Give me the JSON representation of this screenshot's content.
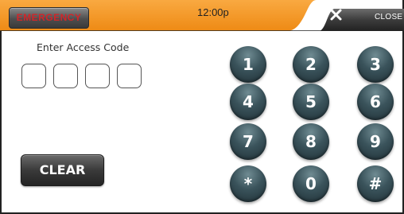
{
  "header": {
    "emergency_label": "EMERGENCY",
    "time": "12:00p",
    "close_label": "CLOSE",
    "bar_color": "#f5941f",
    "emergency_color": "#d0262a"
  },
  "access": {
    "label": "Enter Access Code",
    "digits_entered": 0,
    "boxes": 4
  },
  "clear_label": "CLEAR",
  "keypad": {
    "keys": [
      "1",
      "2",
      "3",
      "4",
      "5",
      "6",
      "7",
      "8",
      "9",
      "*",
      "0",
      "#"
    ]
  }
}
